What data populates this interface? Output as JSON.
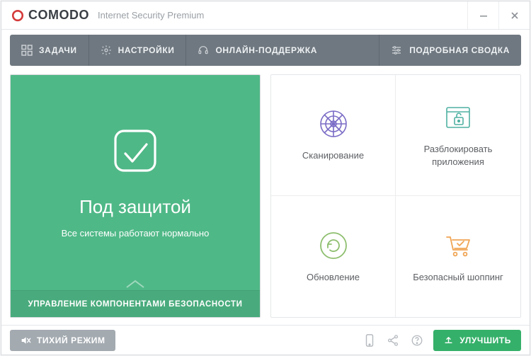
{
  "window": {
    "brand": "COMODO",
    "product": "Internet Security Premium"
  },
  "toolbar": {
    "tasks": "ЗАДАЧИ",
    "settings": "НАСТРОЙКИ",
    "support": "ОНЛАЙН-ПОДДЕРЖКА",
    "detailed": "ПОДРОБНАЯ СВОДКА"
  },
  "status": {
    "title": "Под защитой",
    "subtitle": "Все системы работают нормально",
    "manage": "УПРАВЛЕНИЕ КОМПОНЕНТАМИ БЕЗОПАСНОСТИ"
  },
  "tiles": {
    "scan": "Сканирование",
    "unblock": "Разблокировать приложения",
    "update": "Обновление",
    "shopping": "Безопасный шоппинг"
  },
  "bottom": {
    "silent": "ТИХИЙ РЕЖИМ",
    "upgrade": "УЛУЧШИТЬ"
  },
  "colors": {
    "accent_green": "#4fb887",
    "accent_green_dark": "#35b06a",
    "toolbar_bg": "#6f7880",
    "icon_purple": "#7a6cc6",
    "icon_teal": "#4fb1a2",
    "icon_green": "#8ebf6f",
    "icon_orange": "#f0a555"
  }
}
